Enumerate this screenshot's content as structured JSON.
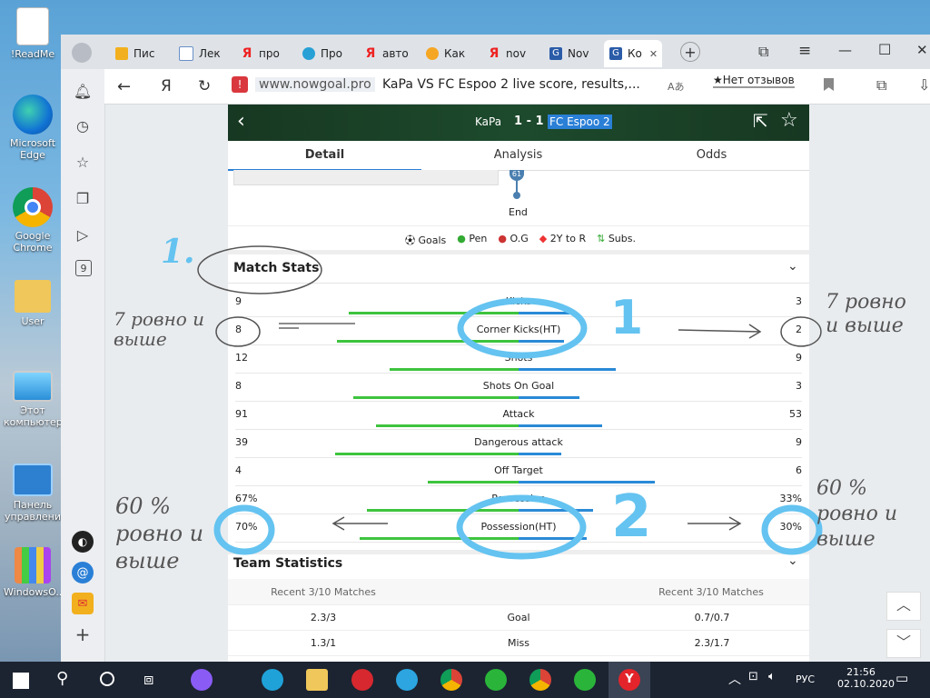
{
  "desktop": {
    "icons": [
      {
        "label": "!ReadMe"
      },
      {
        "label": "Microsoft Edge"
      },
      {
        "label": "Google Chrome"
      },
      {
        "label": "User"
      },
      {
        "label": "Этот компьютер"
      },
      {
        "label": "Панель управлени"
      },
      {
        "label": "WindowsO..."
      }
    ]
  },
  "browser": {
    "tabs": [
      {
        "label": "Пис"
      },
      {
        "label": "Лек"
      },
      {
        "label": "про"
      },
      {
        "label": "Про"
      },
      {
        "label": "авто"
      },
      {
        "label": "Как"
      },
      {
        "label": "nov"
      },
      {
        "label": "Nov"
      },
      {
        "label": "Ко",
        "active": true
      }
    ],
    "new_tab_symbol": "+",
    "address": {
      "domain": "www.nowgoal.pro",
      "title": "KaPa VS FC Espoo 2 live score, results,...",
      "reviews": "★Нет отзывов",
      "translate_symbol": "Aあ"
    },
    "window_controls": {
      "minimize": "—",
      "maximize": "☐",
      "close": "✕",
      "menu": "≡"
    }
  },
  "match": {
    "home": "KaPa",
    "score": "1 - 1",
    "away": "FC Espoo 2",
    "tabs": [
      "Detail",
      "Analysis",
      "Odds"
    ],
    "timeline_minute": "61",
    "end_label": "End",
    "legend": [
      "Goals",
      "Pen",
      "O.G",
      "2Y to R",
      "Subs."
    ],
    "stats_title": "Match Stats",
    "stats": [
      {
        "label": "Kicks",
        "home": "9",
        "away": "3",
        "home_pct": 0.75,
        "away_pct": 0.25
      },
      {
        "label": "Corner Kicks(HT)",
        "home": "8",
        "away": "2",
        "home_pct": 0.8,
        "away_pct": 0.2
      },
      {
        "label": "Shots",
        "home": "12",
        "away": "9",
        "home_pct": 0.57,
        "away_pct": 0.43
      },
      {
        "label": "Shots On Goal",
        "home": "8",
        "away": "3",
        "home_pct": 0.73,
        "away_pct": 0.27
      },
      {
        "label": "Attack",
        "home": "91",
        "away": "53",
        "home_pct": 0.63,
        "away_pct": 0.37
      },
      {
        "label": "Dangerous attack",
        "home": "39",
        "away": "9",
        "home_pct": 0.81,
        "away_pct": 0.19
      },
      {
        "label": "Off Target",
        "home": "4",
        "away": "6",
        "home_pct": 0.4,
        "away_pct": 0.6
      },
      {
        "label": "Possession",
        "home": "67%",
        "away": "33%",
        "home_pct": 0.67,
        "away_pct": 0.33
      },
      {
        "label": "Possession(HT)",
        "home": "70%",
        "away": "30%",
        "home_pct": 0.7,
        "away_pct": 0.3
      }
    ],
    "team_stats_title": "Team Statistics",
    "team_stats_header": {
      "left": "Recent 3/10 Matches",
      "right": "Recent 3/10 Matches"
    },
    "team_stats": [
      {
        "left": "2.3/3",
        "label": "Goal",
        "right": "0.7/0.7"
      },
      {
        "left": "1.3/1",
        "label": "Miss",
        "right": "2.3/1.7"
      }
    ]
  },
  "annotations": {
    "marker1": "1",
    "marker2": "2",
    "left_top": "7 ровно и выше",
    "right_top": "7 ровно и выше",
    "left_bottom": "60 % ровно и выше",
    "right_bottom": "60 % ровно и выше",
    "scribble": "1."
  },
  "taskbar": {
    "time": "21:56",
    "date": "02.10.2020",
    "lang": "РУС"
  },
  "colors": {
    "home_bar": "#3ec43e",
    "away_bar": "#2a8ad6",
    "annotation_blue": "#64c3f0",
    "header_green": "#1d4a2c"
  }
}
